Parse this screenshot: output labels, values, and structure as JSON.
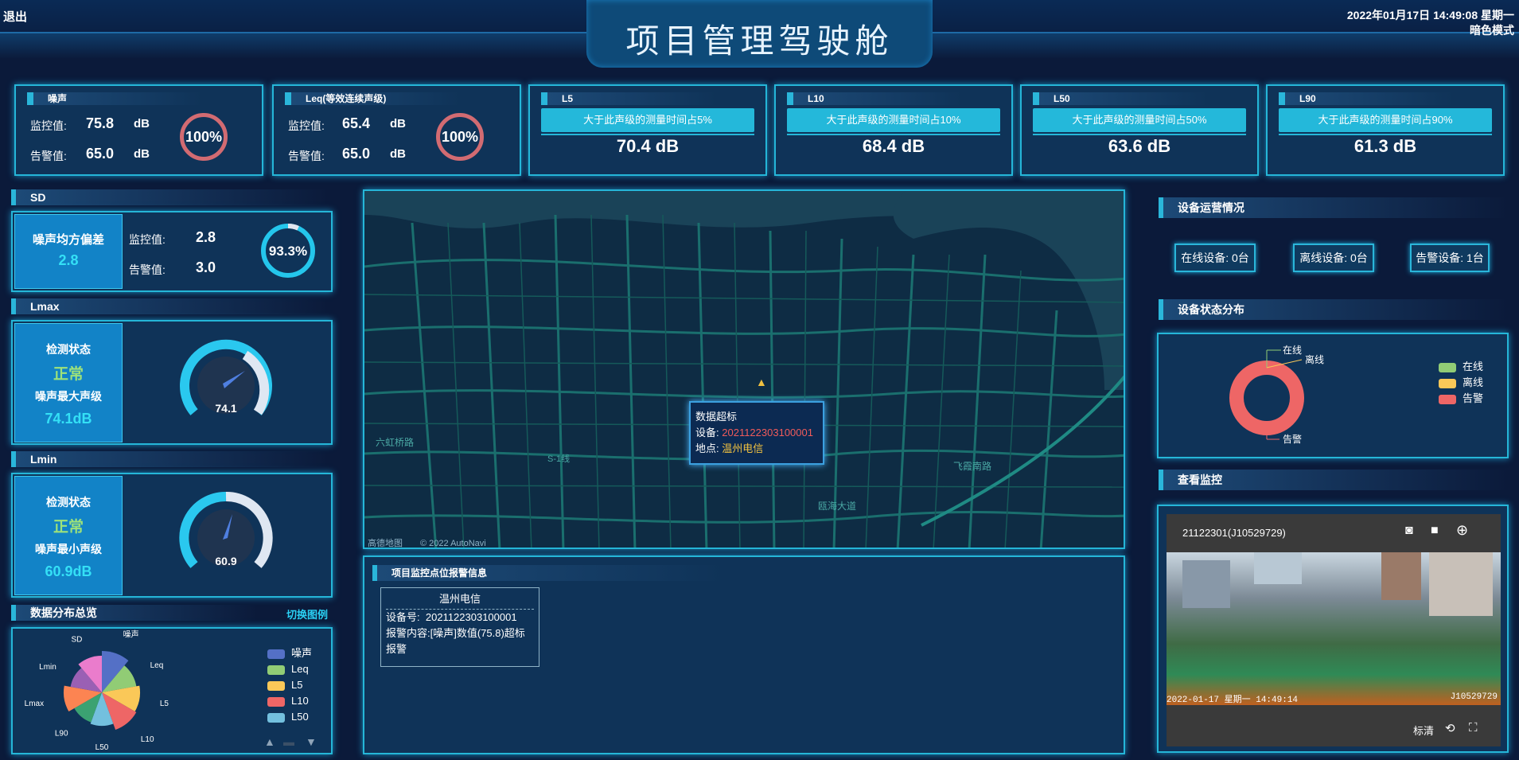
{
  "header": {
    "title": "项目管理驾驶舱",
    "exit": "退出",
    "datetime": "2022年01月17日 14:49:08 星期一",
    "mode": "暗色模式"
  },
  "noise": {
    "title": "噪声",
    "monitor_label": "监控值:",
    "monitor_value": "75.8",
    "alarm_label": "告警值:",
    "alarm_value": "65.0",
    "unit": "dB",
    "percent": "100%"
  },
  "leq": {
    "title": "Leq(等效连续声级)",
    "monitor_label": "监控值:",
    "monitor_value": "65.4",
    "alarm_label": "告警值:",
    "alarm_value": "65.0",
    "unit": "dB",
    "percent": "100%"
  },
  "lcards": [
    {
      "title": "L5",
      "desc": "大于此声级的测量时间占5%",
      "value": "70.4 dB"
    },
    {
      "title": "L10",
      "desc": "大于此声级的测量时间占10%",
      "value": "68.4 dB"
    },
    {
      "title": "L50",
      "desc": "大于此声级的测量时间占50%",
      "value": "63.6 dB"
    },
    {
      "title": "L90",
      "desc": "大于此声级的测量时间占90%",
      "value": "61.3 dB"
    }
  ],
  "sd": {
    "title": "SD",
    "box_label": "噪声均方偏差",
    "box_value": "2.8",
    "monitor_label": "监控值:",
    "monitor_value": "2.8",
    "alarm_label": "告警值:",
    "alarm_value": "3.0",
    "percent": "93.3%",
    "percent_fraction": 0.933
  },
  "lmax": {
    "title": "Lmax",
    "status_label": "检测状态",
    "status": "正常",
    "level_label": "噪声最大声级",
    "level": "74.1dB",
    "gauge": "74.1"
  },
  "lmin": {
    "title": "Lmin",
    "status_label": "检测状态",
    "status": "正常",
    "level_label": "噪声最小声级",
    "level": "60.9dB",
    "gauge": "60.9"
  },
  "dist": {
    "title": "数据分布总览",
    "switch": "切换图例",
    "labels": [
      "噪声",
      "Leq",
      "L5",
      "L10",
      "L50",
      "L90",
      "Lmax",
      "Lmin",
      "SD"
    ],
    "legend": [
      "噪声",
      "Leq",
      "L5",
      "L10",
      "L50"
    ],
    "colors": [
      "#5470c6",
      "#91cc75",
      "#fac858",
      "#ee6666",
      "#73c0de",
      "#3ba272",
      "#fc8452",
      "#9a60b4",
      "#ea7ccc"
    ]
  },
  "map": {
    "road1": "六虹桥路",
    "road2": "S-1线",
    "road3": "瓯海大道",
    "road4": "飞霞南路",
    "road5": "瓯海大道",
    "attrib": "高德地图",
    "copyright": "© 2022 AutoNavi",
    "popup": {
      "title": "数据超标",
      "device_label": "设备:",
      "device": "2021122303100001",
      "place_label": "地点:",
      "place": "温州电信"
    }
  },
  "alarm": {
    "title": "项目监控点位报警信息",
    "item": {
      "name": "温州电信",
      "device_label": "设备号:",
      "device": "2021122303100001",
      "content_label": "报警内容:",
      "content": "[噪声]数值(75.8)超标报警"
    }
  },
  "ops": {
    "title": "设备运营情况",
    "online": "在线设备: 0台",
    "offline": "离线设备: 0台",
    "alarm": "告警设备: 1台"
  },
  "status_dist": {
    "title": "设备状态分布",
    "labels": {
      "online": "在线",
      "offline": "离线",
      "alarm": "告警"
    },
    "legend": [
      "在线",
      "离线",
      "告警"
    ],
    "colors": [
      "#91cc75",
      "#fac858",
      "#ee6666"
    ],
    "values": [
      0,
      0,
      1
    ]
  },
  "camera": {
    "title": "查看监控",
    "id": "21122301(J10529729)",
    "overlay_time": "2022-01-17 星期一 14:49:14",
    "overlay_id": "J10529729",
    "quality": "标清"
  }
}
